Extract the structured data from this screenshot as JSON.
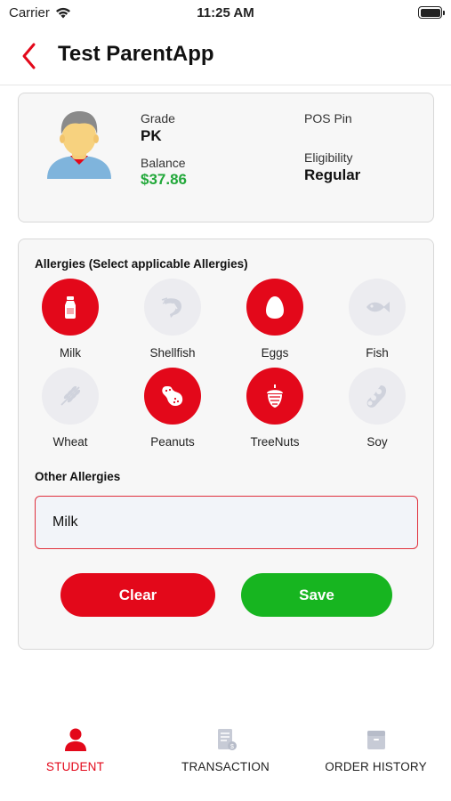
{
  "status_bar": {
    "carrier": "Carrier",
    "time": "11:25 AM"
  },
  "header": {
    "title": "Test ParentApp"
  },
  "student": {
    "grade_label": "Grade",
    "grade_value": "PK",
    "balance_label": "Balance",
    "balance_value": "$37.86",
    "pos_pin_label": "POS Pin",
    "pos_pin_value": "",
    "eligibility_label": "Eligibility",
    "eligibility_value": "Regular"
  },
  "allergies": {
    "title": "Allergies (Select applicable Allergies)",
    "items": [
      {
        "label": "Milk",
        "selected": true,
        "icon": "milk-bottle-icon"
      },
      {
        "label": "Shellfish",
        "selected": false,
        "icon": "shrimp-icon"
      },
      {
        "label": "Eggs",
        "selected": true,
        "icon": "egg-icon"
      },
      {
        "label": "Fish",
        "selected": false,
        "icon": "fish-icon"
      },
      {
        "label": "Wheat",
        "selected": false,
        "icon": "wheat-icon"
      },
      {
        "label": "Peanuts",
        "selected": true,
        "icon": "peanut-icon"
      },
      {
        "label": "TreeNuts",
        "selected": true,
        "icon": "acorn-icon"
      },
      {
        "label": "Soy",
        "selected": false,
        "icon": "soybean-icon"
      }
    ],
    "other_label": "Other Allergies",
    "other_value": "Milk",
    "clear_label": "Clear",
    "save_label": "Save"
  },
  "tabs": [
    {
      "label": "STUDENT",
      "active": true,
      "icon": "person-icon"
    },
    {
      "label": "TRANSACTION",
      "active": false,
      "icon": "receipt-icon"
    },
    {
      "label": "ORDER HISTORY",
      "active": false,
      "icon": "box-icon"
    }
  ],
  "colors": {
    "accent_red": "#e3081a",
    "save_green": "#17b520",
    "balance_green": "#22a83a",
    "inactive_gray": "#ececf0"
  }
}
